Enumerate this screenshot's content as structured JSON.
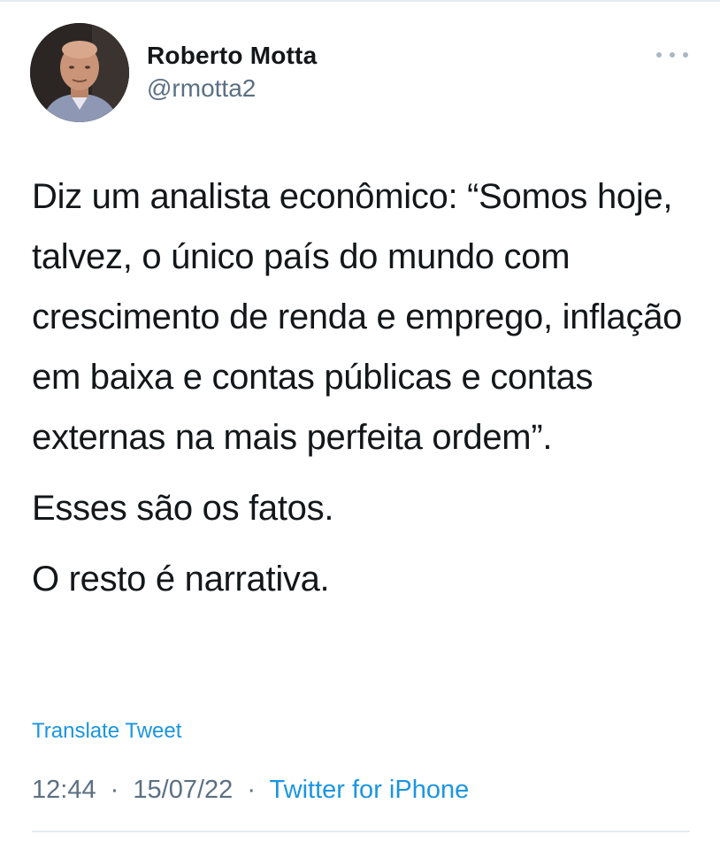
{
  "tweet": {
    "author": {
      "display_name": "Roberto Motta",
      "handle": "@rmotta2"
    },
    "more_icon": "more-horizontal-icon",
    "paragraphs": [
      "Diz um analista econômico: “Somos hoje, talvez, o único país do mundo com crescimento de renda e emprego, inflação em baixa e contas públicas e contas externas na mais perfeita ordem”.",
      "Esses são os fatos.",
      "O resto é narrativa."
    ],
    "translate_label": "Translate Tweet",
    "time": "12:44",
    "date": "15/07/22",
    "separator": "·",
    "source": "Twitter for iPhone"
  },
  "colors": {
    "text": "#14171a",
    "secondary": "#5b7083",
    "link": "#1b95e0",
    "divider": "#e6ecf0"
  }
}
